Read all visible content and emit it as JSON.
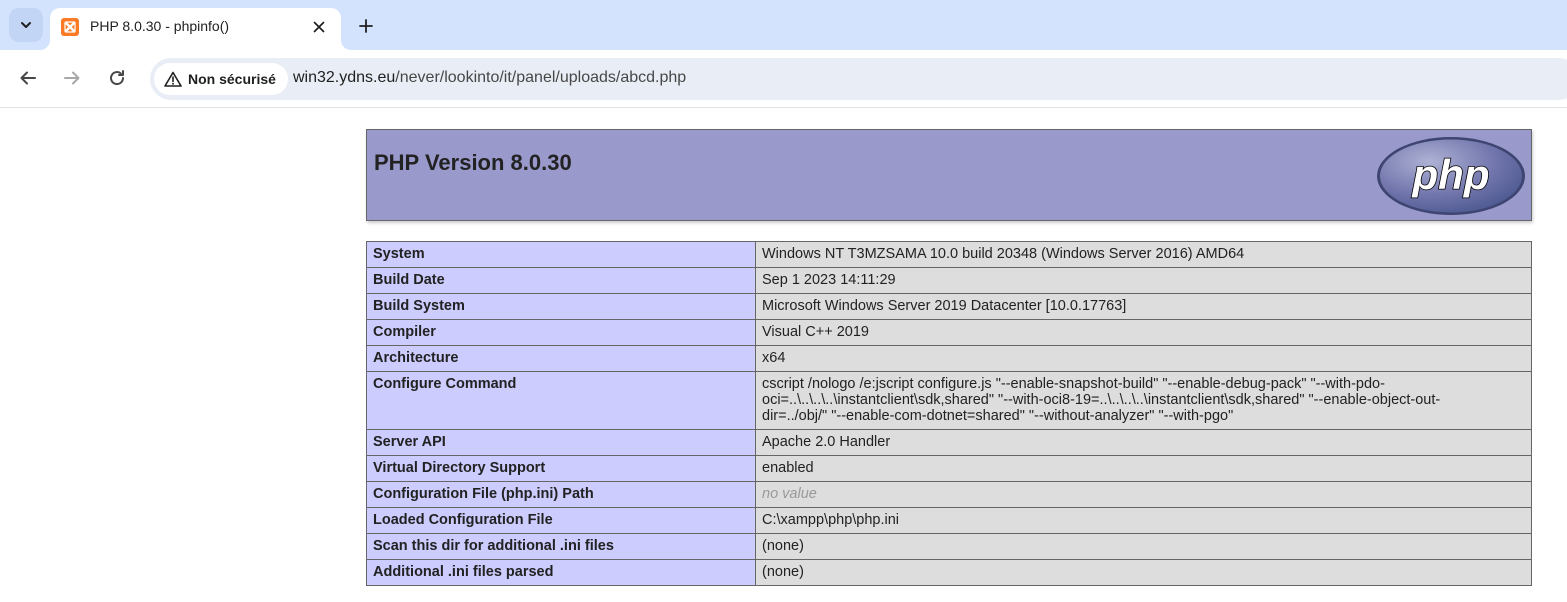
{
  "browser": {
    "tab": {
      "title": "PHP 8.0.30 - phpinfo()"
    },
    "security_label": "Non sécurisé",
    "url_host": "win32.ydns.eu",
    "url_path": "/never/lookinto/it/panel/uploads/abcd.php",
    "icons": [
      "chevron-down-icon",
      "xampp-favicon-icon",
      "close-icon",
      "plus-icon",
      "back-arrow-icon",
      "forward-arrow-icon",
      "reload-icon",
      "warning-icon"
    ]
  },
  "page": {
    "header": {
      "title": "PHP Version 8.0.30",
      "logo_text": "php"
    },
    "rows": [
      {
        "key": "System",
        "value": "Windows NT T3MZSAMA 10.0 build 20348 (Windows Server 2016) AMD64"
      },
      {
        "key": "Build Date",
        "value": "Sep 1 2023 14:11:29"
      },
      {
        "key": "Build System",
        "value": "Microsoft Windows Server 2019 Datacenter [10.0.17763]"
      },
      {
        "key": "Compiler",
        "value": "Visual C++ 2019"
      },
      {
        "key": "Architecture",
        "value": "x64"
      },
      {
        "key": "Configure Command",
        "value_lines": [
          "cscript /nologo /e:jscript configure.js \"--enable-snapshot-build\" \"--enable-debug-pack\" \"--with-pdo-",
          "oci=..\\..\\..\\..\\instantclient\\sdk,shared\" \"--with-oci8-19=..\\..\\..\\..\\instantclient\\sdk,shared\" \"--enable-object-out-",
          "dir=../obj/\" \"--enable-com-dotnet=shared\" \"--without-analyzer\" \"--with-pgo\""
        ]
      },
      {
        "key": "Server API",
        "value": "Apache 2.0 Handler"
      },
      {
        "key": "Virtual Directory Support",
        "value": "enabled"
      },
      {
        "key": "Configuration File (php.ini) Path",
        "value": "no value"
      },
      {
        "key": "Loaded Configuration File",
        "value": "C:\\xampp\\php\\php.ini"
      },
      {
        "key": "Scan this dir for additional .ini files",
        "value": "(none)"
      },
      {
        "key": "Additional .ini files parsed",
        "value": "(none)"
      }
    ]
  },
  "colors": {
    "header_bg": "#9999cc",
    "key_bg": "#ccccff",
    "value_bg": "#dddddd",
    "tabstrip_bg": "#d3e3fd"
  }
}
